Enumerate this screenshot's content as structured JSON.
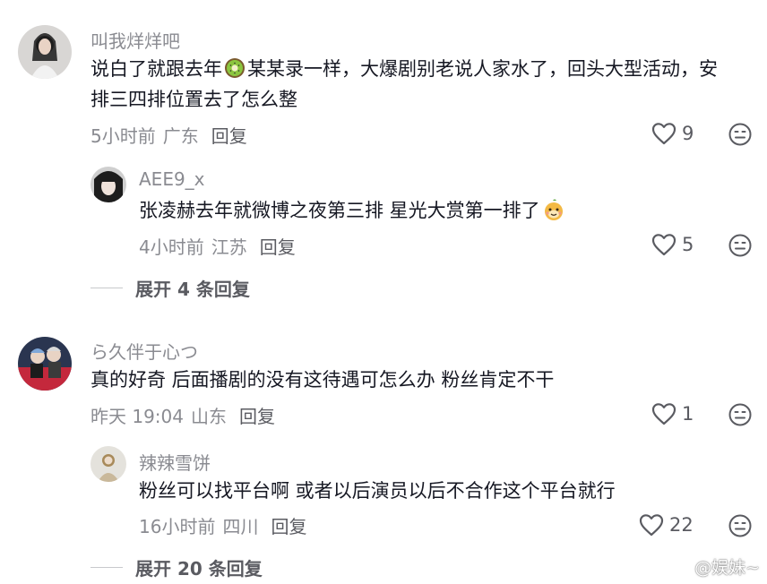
{
  "comments": [
    {
      "username": "叫我烊烊吧",
      "text_before": "说白了就跟去年",
      "text_after": "某某录一样，大爆剧别老说人家水了，回头大型活动，安排三四排位置去了怎么整",
      "time": "5小时前",
      "location": "广东",
      "reply_label": "回复",
      "likes": "9",
      "inline_icon": "kiwi-icon",
      "replies": [
        {
          "username": "AEE9_x",
          "text": "张凌赫去年就微博之夜第三排 星光大赏第一排了",
          "emoji": "smug-dog-emoji",
          "time": "4小时前",
          "location": "江苏",
          "reply_label": "回复",
          "likes": "5"
        }
      ],
      "expand_label": "展开 4 条回复"
    },
    {
      "username": "ら久伴于心つ",
      "text": "真的好奇 后面播剧的没有这待遇可怎么办 粉丝肯定不干",
      "time": "昨天 19:04",
      "location": "山东",
      "reply_label": "回复",
      "likes": "1",
      "replies": [
        {
          "username": "辣辣雪饼",
          "text": "粉丝可以找平台啊 或者以后演员以后不合作这个平台就行",
          "time": "16小时前",
          "location": "四川",
          "reply_label": "回复",
          "likes": "22"
        }
      ],
      "expand_label": "展开 20 条回复"
    }
  ],
  "watermark": "@娱妹~",
  "colors": {
    "text": "#161823",
    "secondary": "#8a8b91",
    "action": "#5a5b61"
  }
}
